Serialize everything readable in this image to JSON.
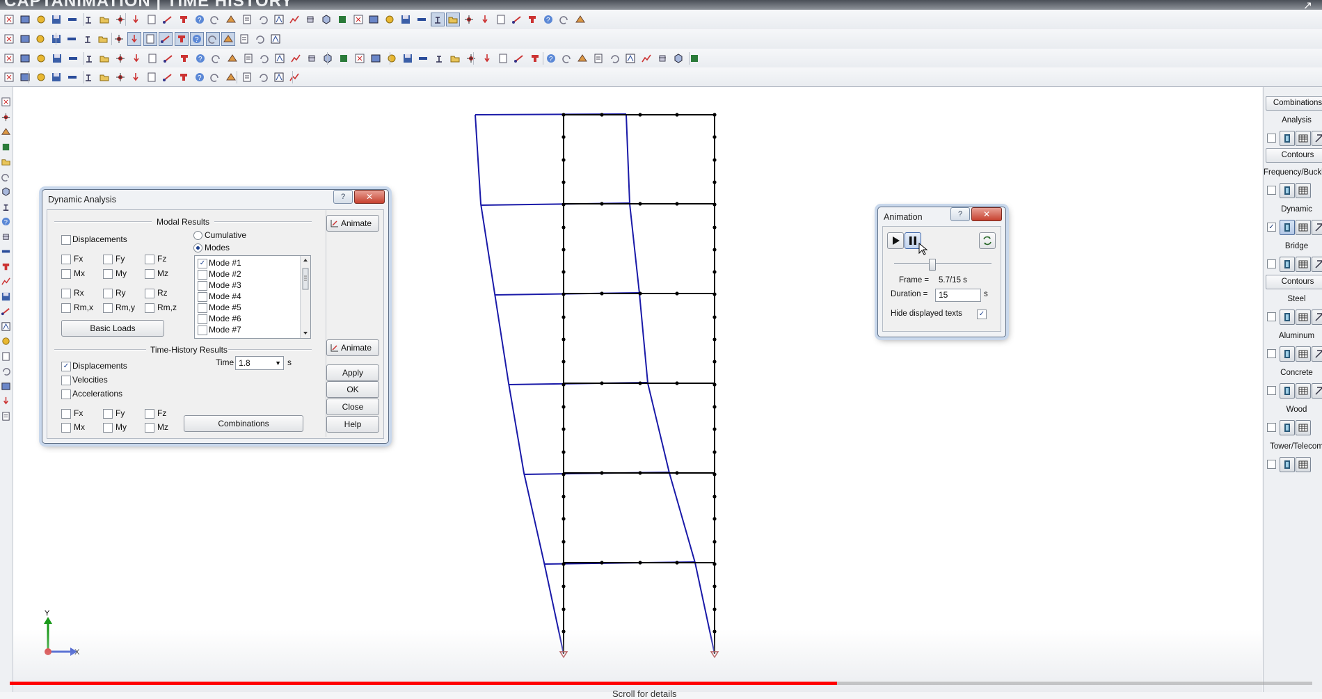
{
  "caption": {
    "text": "CAPTANIMATION | TIME HISTORY",
    "share": "↗"
  },
  "colors": {
    "frame_original": "#000000",
    "frame_deformed": "#1a1aa8",
    "progress": "#ff0000",
    "title_bar_glow": "#c9d8ec"
  },
  "toolbar": {
    "icons": [
      "new-icon",
      "open-icon",
      "save-icon",
      "close-model-icon",
      "print-icon",
      "undo-icon",
      "redo-icon",
      "link-icon",
      "node-icon",
      "member-icon",
      "plate-icon",
      "solid-icon",
      "view-icon",
      "render-icon",
      "section-icon",
      "load-icon",
      "support-icon",
      "release-icon",
      "analysis-icon",
      "results-icon",
      "design-icon",
      "report-icon",
      "help-icon"
    ]
  },
  "dynamic_dialog": {
    "title": "Dynamic Analysis",
    "help": "?",
    "close": "✕",
    "modal_results": {
      "title": "Modal Results",
      "displacements": "Displacements",
      "force_labels": [
        "Fx",
        "Fy",
        "Fz",
        "Mx",
        "My",
        "Mz"
      ],
      "rot_labels": [
        "Rx",
        "Ry",
        "Rz",
        "Rm,x",
        "Rm,y",
        "Rm,z"
      ],
      "basic_loads": "Basic Loads",
      "cumulative": "Cumulative",
      "modes": "Modes",
      "mode_list": [
        "Mode #1",
        "Mode #2",
        "Mode #3",
        "Mode #4",
        "Mode #5",
        "Mode #6",
        "Mode #7"
      ],
      "animate": "Animate"
    },
    "time_history": {
      "title": "Time-History Results",
      "displacements": "Displacements",
      "velocities": "Velocities",
      "accelerations": "Accelerations",
      "force_labels": [
        "Fx",
        "Fy",
        "Fz",
        "Mx",
        "My",
        "Mz"
      ],
      "time_label": "Time",
      "time_value": "1.8",
      "time_unit": "s",
      "combinations": "Combinations",
      "animate": "Animate"
    },
    "buttons": {
      "apply": "Apply",
      "ok": "OK",
      "close": "Close",
      "help": "Help"
    }
  },
  "animation_dialog": {
    "title": "Animation",
    "help": "?",
    "close": "✕",
    "frame_label": "Frame =",
    "frame_value": "5.7/15 s",
    "duration_label": "Duration =",
    "duration_value": "15",
    "duration_unit": "s",
    "hide_texts": "Hide displayed texts",
    "slider_position": 0.38
  },
  "right_panel": {
    "combinations": "Combinations",
    "analysis": "Analysis",
    "contours_1": "Contours",
    "frequency": "Frequency/Buckling",
    "dynamic": "Dynamic",
    "bridge": "Bridge",
    "contours_2": "Contours",
    "steel": "Steel",
    "aluminum": "Aluminum",
    "concrete": "Concrete",
    "wood": "Wood",
    "tower": "Tower/Telecom"
  },
  "axes": {
    "y": "Y",
    "x": "X"
  },
  "progress": {
    "fraction": 0.635
  },
  "bottom_caption": "Scroll for details"
}
